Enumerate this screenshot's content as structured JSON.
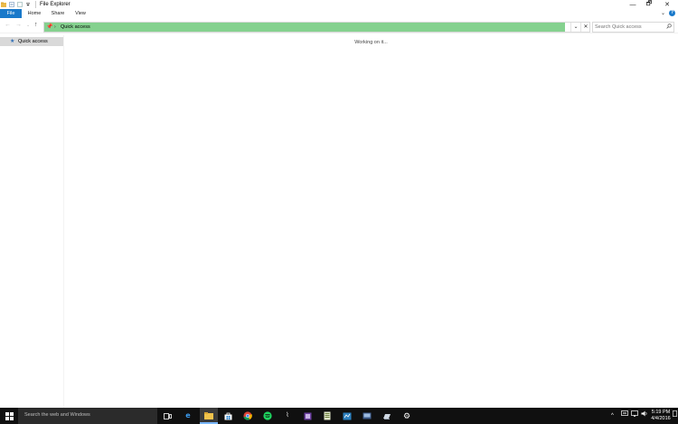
{
  "window": {
    "title": "File Explorer",
    "controls": {
      "minimize": "—",
      "maximize": "🗗",
      "close": "✕"
    }
  },
  "ribbon": {
    "tabs": [
      {
        "label": "File",
        "active": true
      },
      {
        "label": "Home"
      },
      {
        "label": "Share"
      },
      {
        "label": "View"
      }
    ],
    "expand_icon": "chevron-down-icon",
    "help_glyph": "?"
  },
  "navigation": {
    "back": "←",
    "forward": "→",
    "recent": "⌄",
    "up": "↑"
  },
  "address_bar": {
    "location": "Quick access",
    "separator": "›",
    "progress_color": "#85d18f",
    "progress_fraction": 0.955
  },
  "search": {
    "placeholder": "Search Quick access"
  },
  "nav_pane": {
    "items": [
      {
        "label": "Quick access",
        "selected": true
      }
    ]
  },
  "content": {
    "status": "Working on it..."
  },
  "taskbar": {
    "search_placeholder": "Search the web and Windows",
    "pinned": [
      {
        "name": "task-view-icon"
      },
      {
        "name": "edge-icon"
      },
      {
        "name": "file-explorer-icon",
        "active": true
      },
      {
        "name": "store-icon"
      },
      {
        "name": "chrome-icon"
      },
      {
        "name": "spotify-icon"
      },
      {
        "name": "app-icon"
      },
      {
        "name": "app-icon"
      },
      {
        "name": "app-icon"
      },
      {
        "name": "app-icon"
      },
      {
        "name": "app-icon"
      },
      {
        "name": "app-icon"
      },
      {
        "name": "settings-icon"
      }
    ],
    "tray": {
      "chevron": "^"
    },
    "clock": {
      "time": "5:19 PM",
      "date": "4/4/2016"
    }
  },
  "colors": {
    "accent": "#1979ca",
    "taskbar": "#101010",
    "selected_nav": "#d9d9d9"
  }
}
